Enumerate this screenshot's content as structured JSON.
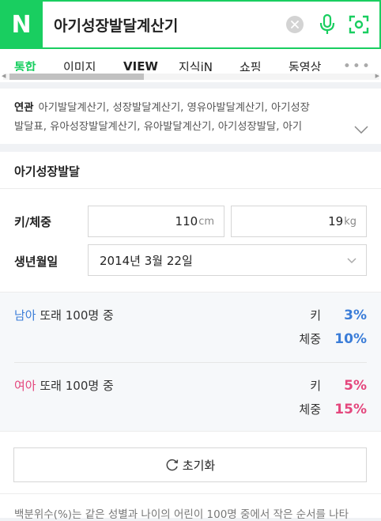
{
  "search": {
    "logo": "N",
    "query": "아기성장발달계산기"
  },
  "tabs": [
    "통합",
    "이미지",
    "VIEW",
    "지식iN",
    "쇼핑",
    "동영상"
  ],
  "more_label": "•••",
  "related": {
    "label": "연관",
    "line1": "아기발달계산기, 성장발달계산기, 영유아발달계산기, 아기성장",
    "line2": "발달표, 유아성장발달계산기, 유아발달계산기, 아기성장발달, 아기"
  },
  "calc": {
    "title": "아기성장발달",
    "size_label": "키/체중",
    "height_value": "110",
    "height_unit": "cm",
    "weight_value": "19",
    "weight_unit": "kg",
    "birth_label": "생년월일",
    "birth_value": "2014년 3월 22일"
  },
  "boy": {
    "gender": "남아",
    "suffix": " 또래 100명 중",
    "height_label": "키",
    "height_pct": "3%",
    "weight_label": "체중",
    "weight_pct": "10%"
  },
  "girl": {
    "gender": "여아",
    "suffix": " 또래 100명 중",
    "height_label": "키",
    "height_pct": "5%",
    "weight_label": "체중",
    "weight_pct": "15%"
  },
  "reset_label": "초기화",
  "footnote": "백분위수(%)는 같은 성별과 나이의 어린이 100명 중에서 작은 순서를 나타",
  "colors": {
    "brand": "#19ce60",
    "boy": "#3b7dd8",
    "girl": "#e4477d"
  },
  "icons": [
    "clear-icon",
    "mic-icon",
    "lens-icon",
    "chevron-down-icon",
    "refresh-icon"
  ]
}
